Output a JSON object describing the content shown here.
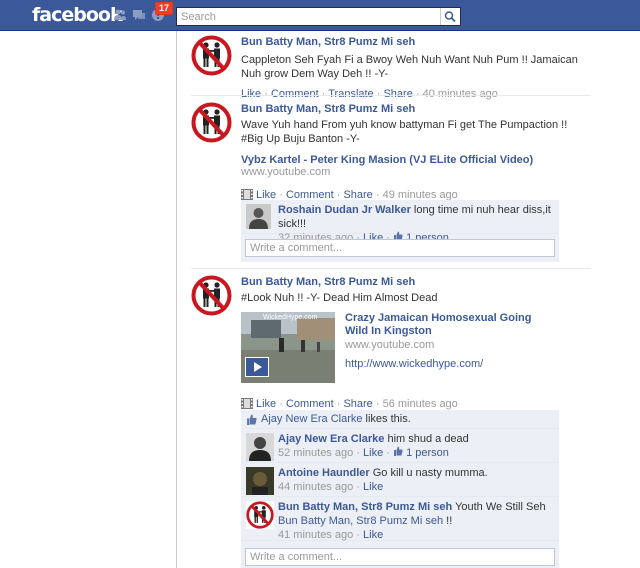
{
  "topbar": {
    "logo": "facebook",
    "notif_count": "17",
    "search_placeholder": "Search"
  },
  "colors": {
    "brand": "#3b5998",
    "link": "#3b5998",
    "meta": "#999999",
    "ufi_bg": "#eceff5",
    "badge": "#f03d25"
  },
  "icons": [
    "friend-requests-icon",
    "messages-icon",
    "notifications-icon",
    "search-icon",
    "thumbs-up-icon",
    "film-icon",
    "no-gay-symbol-avatar"
  ],
  "posts": [
    {
      "author": "Bun Batty Man, Str8 Pumz Mi seh",
      "text": "Cappleton Seh Fyah Fi a Bwoy Weh Nuh Want Nuh Pum !! Jamaican Nuh grow Dem Way Deh !! -Y-",
      "actions": {
        "like": "Like",
        "comment": "Comment",
        "translate": "Translate",
        "share": "Share",
        "time": "40 minutes ago"
      }
    },
    {
      "author": "Bun Batty Man, Str8 Pumz Mi seh",
      "text": "Wave Yuh hand From yuh know battyman Fi get The Pumpaction !! #Big Up Buju Banton -Y-",
      "link_title": "Vybz Kartel - Peter King Masion (VJ ELite Official Video)",
      "link_url": "www.youtube.com",
      "actions": {
        "like": "Like",
        "comment": "Comment",
        "share": "Share",
        "time": "49 minutes ago"
      },
      "comments": [
        {
          "author": "Roshain Dudan Jr Walker",
          "text": "long time mi nuh hear diss,it sick!!!",
          "time": "32 minutes ago",
          "like": "Like",
          "likes": "1 person"
        }
      ],
      "write_placeholder": "Write a comment..."
    },
    {
      "author": "Bun Batty Man, Str8 Pumz Mi seh",
      "text": "#Look Nuh !! -Y- Dead Him Almost Dead",
      "video": {
        "title": "Crazy Jamaican Homosexual Going Wild In Kingston",
        "url": "www.youtube.com",
        "link": "http://www.wickedhype.com/",
        "watermark": "WickedHype.com"
      },
      "actions": {
        "like": "Like",
        "comment": "Comment",
        "share": "Share",
        "time": "56 minutes ago"
      },
      "likes_line": {
        "name": "Ajay New Era Clarke",
        "suffix": "likes this."
      },
      "comments": [
        {
          "author": "Ajay New Era Clarke",
          "text": "him shud a dead",
          "time": "52 minutes ago",
          "like": "Like",
          "likes": "1 person"
        },
        {
          "author": "Antoine Haundler",
          "text": "Go kill u nasty mumma.",
          "time": "44 minutes ago",
          "like": "Like"
        },
        {
          "author": "Bun Batty Man, Str8 Pumz Mi seh",
          "text": "Youth We Still Seh",
          "mention": "Bun Batty Man, Str8 Pumz Mi seh",
          "tail": "!!",
          "time": "41 minutes ago",
          "like": "Like"
        }
      ],
      "write_placeholder": "Write a comment..."
    }
  ]
}
